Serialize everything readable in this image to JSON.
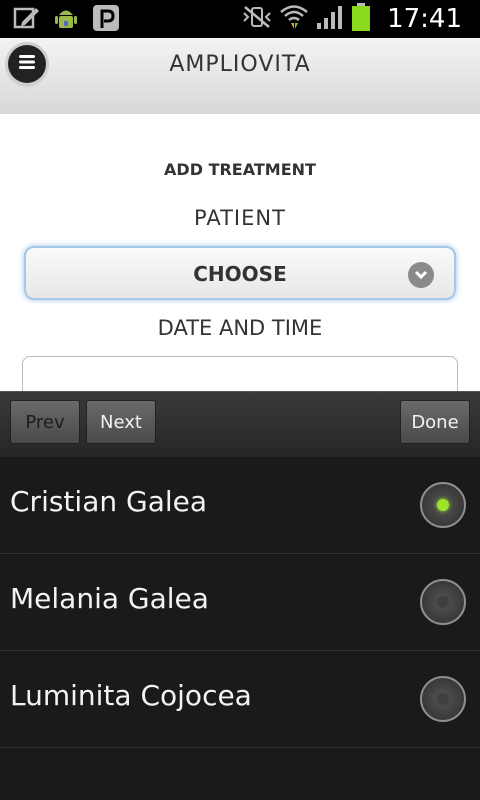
{
  "status_bar": {
    "time": "17:41",
    "icons": [
      "edit-icon",
      "android-icon",
      "pinterest-icon",
      "vibrate-mute-icon",
      "wifi-icon",
      "signal-icon",
      "battery-icon"
    ]
  },
  "app": {
    "title": "AMPLIOVITA",
    "menu_icon": "menu-icon"
  },
  "form": {
    "section_title": "ADD TREATMENT",
    "patient_label": "PATIENT",
    "patient_select": {
      "selected_value": "CHOOSE"
    },
    "date_label": "DATE AND TIME",
    "date_input": {
      "value": ""
    }
  },
  "picker_toolbar": {
    "prev_label": "Prev",
    "next_label": "Next",
    "done_label": "Done"
  },
  "options": [
    {
      "label": "Cristian Galea",
      "selected": true
    },
    {
      "label": "Melania Galea",
      "selected": false
    },
    {
      "label": "Luminita Cojocea",
      "selected": false
    }
  ],
  "colors": {
    "radio_selected": "#9be42a",
    "select_focus": "#9cc2e6",
    "battery": "#8ad91e"
  }
}
